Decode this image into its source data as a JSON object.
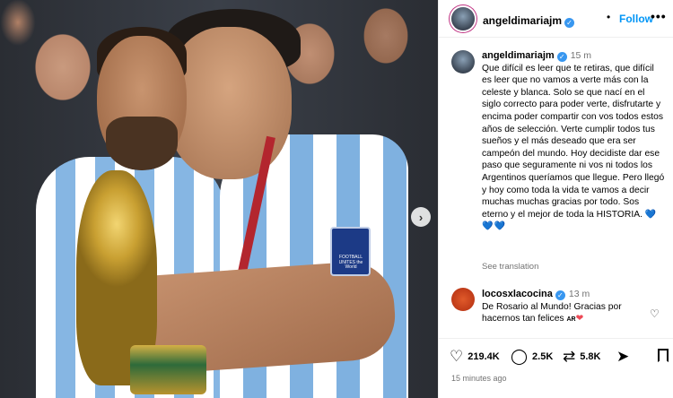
{
  "post": {
    "username": "angeldimariajm",
    "follow_label": "Follow",
    "more_label": "•••",
    "header_dot": "•"
  },
  "caption": {
    "username": "angeldimariajm",
    "time": "15 m",
    "text": "Que difícil es leer que te retiras, que difícil es leer que no vamos a verte más con la celeste y blanca. Solo se que nací en el siglo correcto para poder verte, disfrutarte y encima poder compartir con vos todos estos años de selección. Verte cumplir todos tus sueños y el más deseado que era ser campeón del mundo. Hoy decidiste dar ese paso que seguramente ni vos ni todos los Argentinos queríamos que llegue. Pero llegó y hoy como toda la vida te vamos a decir  muchas muchas gracias por todo. Sos eterno y el mejor de toda la HISTORIA.",
    "hearts": "💙💙💙",
    "see_translation": "See translation"
  },
  "comment": {
    "username": "locosxlacocina",
    "time": "13 m",
    "text": "De Rosario al Mundo! Gracias por hacernos tan felices",
    "tag": "AR",
    "emoji": "❤"
  },
  "actions": {
    "likes": "219.4K",
    "comments": "2.5K",
    "reposts": "5.8K",
    "timestamp": "15 minutes ago"
  },
  "photo": {
    "patch_text": "FOOTBALL UNITES the World"
  },
  "icons": {
    "like": "heart-icon",
    "comment": "comment-icon",
    "repost": "repost-icon",
    "share": "share-icon",
    "save": "bookmark-icon",
    "next": "chevron-right-icon"
  },
  "colors": {
    "follow": "#0095f6",
    "verified": "#3897f0",
    "muted": "#737373",
    "heart_red": "#ed4956"
  }
}
